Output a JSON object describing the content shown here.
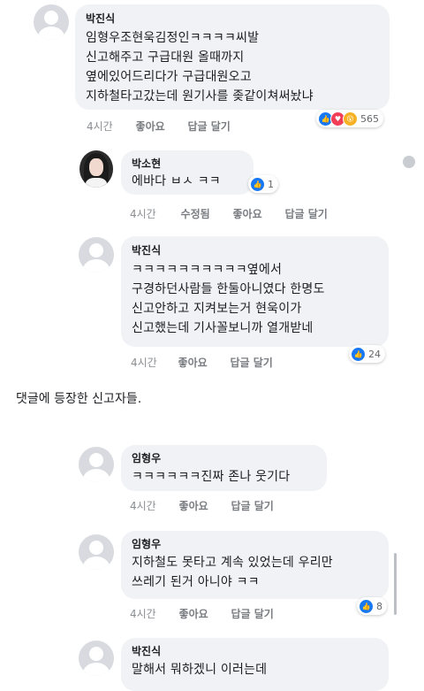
{
  "comments": [
    {
      "name": "박진식",
      "text": "임형우조현욱김정인ㅋㅋㅋㅋ씨발\n신고해주고 구급대원 올때까지\n옆에있어드리다가 구급대원오고\n지하철타고갔는데 원기사를 좆같이쳐써놨냐",
      "time": "4시간",
      "like": "좋아요",
      "reply": "답글 달기",
      "reactions": [
        "like-icon",
        "love-icon",
        "wow-icon"
      ],
      "reaction_count": "565"
    },
    {
      "name": "박소현",
      "text": "에바다 ㅂㅅ ㅋㅋ",
      "time": "4시간",
      "edited": "수정됨",
      "like": "좋아요",
      "reply": "답글 달기",
      "reactions": [
        "like-icon"
      ],
      "reaction_count": "1"
    },
    {
      "name": "박진식",
      "text": "ㅋㅋㅋㅋㅋㅋㅋㅋㅋㅋ옆에서\n구경하던사람들 한둘아니였다 한명도\n신고안하고 지켜보는거 현욱이가\n신고했는데 기사꼴보니까 열개받네",
      "time": "4시간",
      "like": "좋아요",
      "reply": "답글 달기",
      "reactions": [
        "like-icon"
      ],
      "reaction_count": "24"
    },
    {
      "name": "임형우",
      "text": "ㅋㅋㅋㅋㅋㅋ진짜 존나 웃기다",
      "time": "4시간",
      "like": "좋아요",
      "reply": "답글 달기"
    },
    {
      "name": "임형우",
      "text": "지하철도 못타고 계속 있었는데 우리만\n쓰레기 된거 아니야 ㅋㅋ",
      "time": "4시간",
      "like": "좋아요",
      "reply": "답글 달기",
      "reactions": [
        "like-icon"
      ],
      "reaction_count": "8"
    },
    {
      "name": "박진식",
      "text": "말해서 뭐하겠니 이러는데"
    }
  ],
  "caption": "댓글에 등장한 신고자들.",
  "colors": {
    "bubble": "#f0f2f5",
    "meta": "#8a8d91",
    "like": "#1877f2",
    "love": "#f33e58",
    "wow": "#f7b125"
  }
}
